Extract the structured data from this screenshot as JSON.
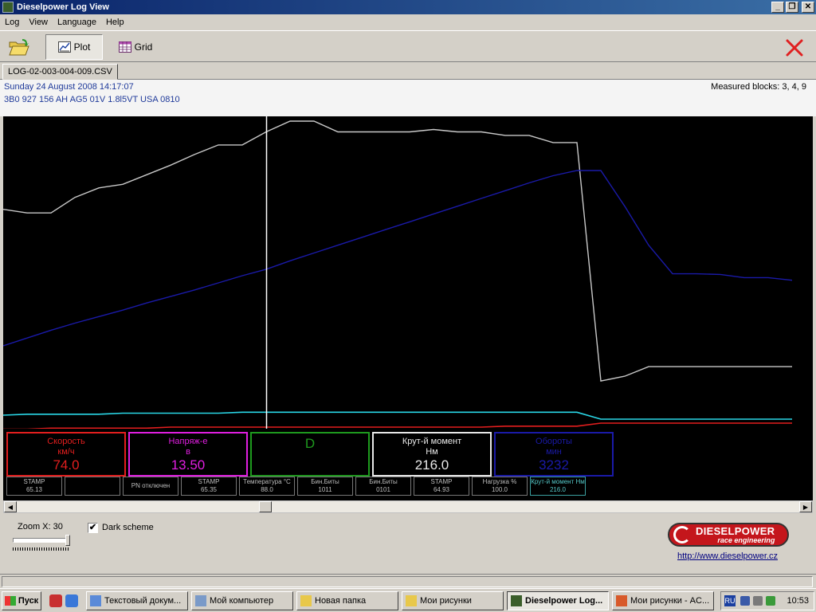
{
  "window": {
    "title": "Dieselpower Log View",
    "controls": {
      "minimize": "_",
      "maximize": "❐",
      "close": "✕"
    }
  },
  "menu": [
    "Log",
    "View",
    "Language",
    "Help"
  ],
  "toolbar": {
    "open_icon": "folder-open-icon",
    "plot_label": "Plot",
    "grid_label": "Grid",
    "exit_icon": "red-x-icon"
  },
  "tab": {
    "label": "LOG-02-003-004-009.CSV"
  },
  "info": {
    "date": "Sunday 24 August 2008 14:17:07",
    "ecu": "3B0 927 156 AH  AG5 01V 1.8l5VT USA 0810",
    "blocks": "Measured blocks: 3, 4, 9"
  },
  "gauges": [
    {
      "label": "Скорость",
      "unit": "км/ч",
      "value": "74.0",
      "color": "#e31e1e"
    },
    {
      "label": "Напряж-е",
      "unit": "в",
      "value": "13.50",
      "color": "#e01ee0"
    },
    {
      "label": "",
      "unit": "",
      "value": "D",
      "color": "#1e9a1e"
    },
    {
      "label": "Крут-й момент",
      "unit": "Нм",
      "value": "216.0",
      "color": "#e8e8e8"
    },
    {
      "label": "Обороты",
      "unit": "мин",
      "value": "3232",
      "color": "#1a1aa8"
    }
  ],
  "minis": [
    {
      "label": "STAMP",
      "value": "65.13"
    },
    {
      "label": "",
      "value": ""
    },
    {
      "label": "",
      "value": "PN отключен"
    },
    {
      "label": "STAMP",
      "value": "65.35"
    },
    {
      "label": "Температура °C",
      "value": "88.0"
    },
    {
      "label": "Бин.Биты",
      "value": "1011"
    },
    {
      "label": "Бин.Биты",
      "value": "0101"
    },
    {
      "label": "STAMP",
      "value": "64.93"
    },
    {
      "label": "Нагрузка %",
      "value": "100.0"
    },
    {
      "label": "Крут-й момент Нм",
      "value": "216.0"
    }
  ],
  "chart_data": {
    "type": "line",
    "x": [
      0,
      1,
      2,
      3,
      4,
      5,
      6,
      7,
      8,
      9,
      10,
      11,
      12,
      13,
      14,
      15,
      16,
      17,
      18,
      19,
      20,
      21,
      22,
      23,
      24,
      25,
      26,
      27,
      28,
      29,
      30,
      31,
      32,
      33
    ],
    "cursor_x": 11,
    "series": [
      {
        "color": "#c8c8c8",
        "values": [
          216,
          213,
          213,
          226,
          234,
          237,
          245,
          253,
          262,
          270,
          270,
          281,
          290,
          290,
          281,
          281,
          281,
          281,
          283,
          281,
          281,
          278,
          278,
          272,
          272,
          72,
          76,
          84,
          84,
          84,
          84,
          84,
          84,
          84
        ]
      },
      {
        "color": "#1a1aa8",
        "values": [
          1750,
          1870,
          1990,
          2100,
          2200,
          2300,
          2410,
          2510,
          2610,
          2720,
          2830,
          2930,
          3060,
          3180,
          3300,
          3420,
          3540,
          3660,
          3780,
          3900,
          4020,
          4140,
          4260,
          4370,
          4450,
          4450,
          3900,
          3300,
          2860,
          2860,
          2850,
          2800,
          2800,
          2760
        ]
      },
      {
        "color": "#2ad8e8",
        "values": [
          20,
          21,
          21,
          21,
          21,
          22,
          22,
          22,
          22,
          22,
          23,
          23,
          23,
          23,
          23,
          23,
          23,
          23,
          23,
          23,
          23,
          23,
          23,
          23,
          23,
          16,
          16,
          16,
          16,
          16,
          16,
          16,
          16,
          16
        ]
      },
      {
        "color": "#e31e1e",
        "values": [
          10,
          10,
          11,
          11,
          11,
          11,
          11,
          12,
          12,
          12,
          12,
          12,
          12,
          12,
          12,
          12,
          12,
          12,
          12,
          12,
          12,
          13,
          13,
          13,
          13,
          16,
          16,
          16,
          16,
          16,
          16,
          16,
          16,
          16
        ]
      },
      {
        "color": "#e01ee0",
        "values": [
          9,
          9,
          9,
          9,
          9,
          9,
          9,
          9,
          9,
          9,
          9,
          9,
          9,
          9,
          9,
          9,
          9,
          9,
          9,
          9,
          9,
          9,
          9,
          9,
          9,
          9,
          9,
          9,
          9,
          9,
          9,
          9,
          9,
          9
        ]
      }
    ]
  },
  "bottom": {
    "zoom_label": "Zoom X: 30",
    "zoom_value": 30,
    "dark_scheme_label": "Dark scheme",
    "dark_scheme_checked": "✔",
    "logo_name": "DIESELPOWER",
    "logo_sub": "race engineering",
    "link": "http://www.dieselpower.cz"
  },
  "taskbar": {
    "start_label": "Пуск",
    "tasks": [
      {
        "label": "Текстовый докум...",
        "active": false
      },
      {
        "label": "Мой компьютер",
        "active": false
      },
      {
        "label": "Новая папка",
        "active": false
      },
      {
        "label": "Мои рисунки",
        "active": false
      },
      {
        "label": "Dieselpower Log...",
        "active": true
      },
      {
        "label": "Мои рисунки - AC...",
        "active": false
      }
    ],
    "lang": "RU",
    "clock": "10:53"
  }
}
